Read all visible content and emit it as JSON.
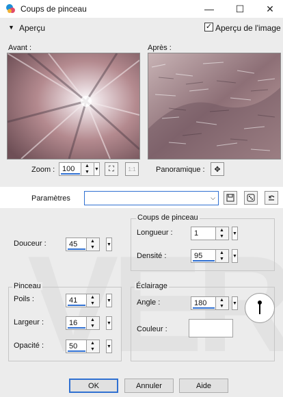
{
  "window": {
    "title": "Coups de pinceau",
    "minimize": "—",
    "maximize": "☐",
    "close": "✕"
  },
  "preview": {
    "toggle_label": "Aperçu",
    "checkbox_label": "Aperçu de l'image",
    "checkbox_checked": true,
    "before_label": "Avant :",
    "after_label": "Après :"
  },
  "zoom": {
    "label": "Zoom :",
    "value": "100",
    "zoom_fit_icon": "⛶",
    "one_to_one_icon": "1:1"
  },
  "pan": {
    "label": "Panoramique :",
    "move_icon": "✥"
  },
  "params": {
    "label": "Paramètres",
    "value": ""
  },
  "douceur": {
    "label": "Douceur :",
    "value": "45"
  },
  "brushstrokes": {
    "title": "Coups de pinceau",
    "length_label": "Longueur :",
    "length_value": "1",
    "density_label": "Densité :",
    "density_value": "95"
  },
  "brush": {
    "title": "Pinceau",
    "bristles_label": "Poils :",
    "bristles_value": "41",
    "width_label": "Largeur :",
    "width_value": "16",
    "opacity_label": "Opacité :",
    "opacity_value": "50"
  },
  "lighting": {
    "title": "Éclairage",
    "angle_label": "Angle :",
    "angle_value": "180",
    "color_label": "Couleur :",
    "color_value": "#ffffff"
  },
  "buttons": {
    "ok": "OK",
    "cancel": "Annuler",
    "help": "Aide"
  },
  "watermark": "VER",
  "colors": {
    "accent": "#2e6fd1",
    "titlebar": "#ffffff",
    "dialog": "#ececec"
  }
}
